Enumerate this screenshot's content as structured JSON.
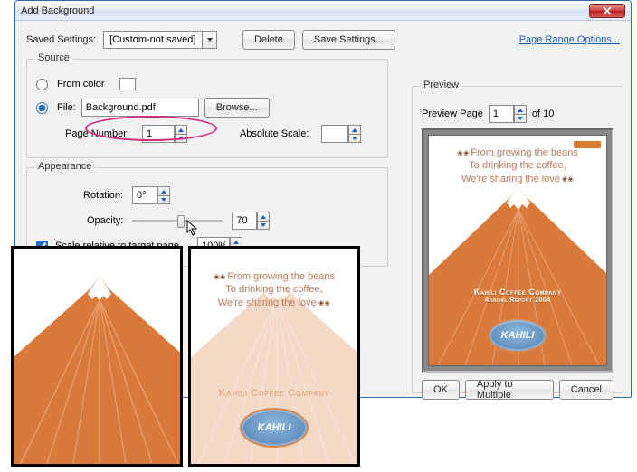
{
  "window": {
    "title": "Add Background"
  },
  "top": {
    "savedSettingsLabel": "Saved Settings:",
    "savedSettingsValue": "[Custom-not saved]",
    "deleteLabel": "Delete",
    "saveSettingsLabel": "Save Settings...",
    "pageRangeLink": "Page Range Options..."
  },
  "source": {
    "title": "Source",
    "fromColorLabel": "From color",
    "fileLabel": "File:",
    "fileValue": "Background.pdf",
    "browseLabel": "Browse...",
    "pageNumberLabel": "Page Number:",
    "pageNumberValue": "1",
    "absoluteScaleLabel": "Absolute Scale:",
    "absoluteScaleValue": ""
  },
  "appearance": {
    "title": "Appearance",
    "rotationLabel": "Rotation:",
    "rotationValue": "0°",
    "opacityLabel": "Opacity:",
    "opacityValue": "70",
    "scaleRelLabel": "Scale relative to target page",
    "scaleRelChecked": true,
    "scaleRelValue": "100%"
  },
  "preview": {
    "title": "Preview",
    "pageLabel": "Preview Page",
    "pageValue": "1",
    "ofLabel": "of 10",
    "docTitle1": "Kahili Coffee Company",
    "docTitle2": "Annual Report 2004",
    "logoText": "KAHILI",
    "heroLine1": "From growing the beans",
    "heroLine2": "To drinking the coffee,",
    "heroLine3": "We're sharing the love"
  },
  "buttons": {
    "ok": "OK",
    "applyMultiple": "Apply to Multiple",
    "cancel": "Cancel"
  }
}
